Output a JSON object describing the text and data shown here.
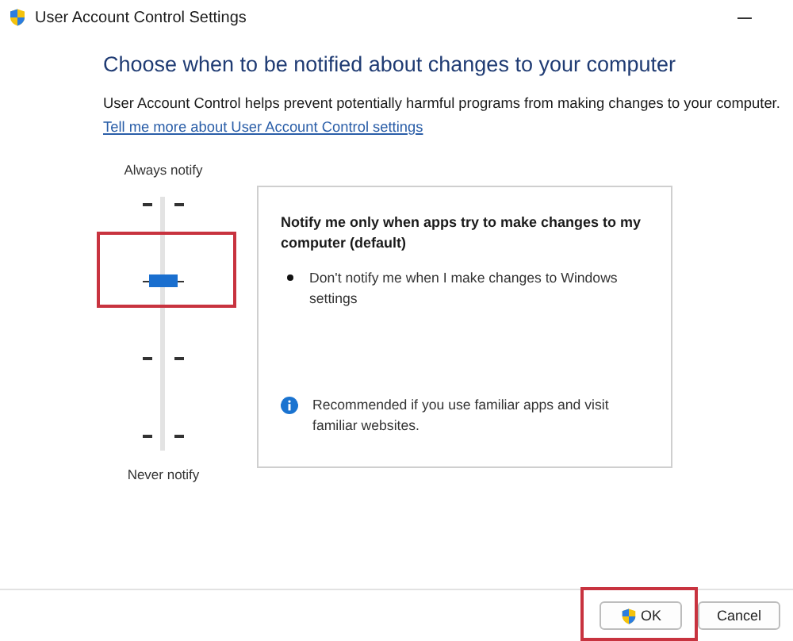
{
  "window": {
    "title": "User Account Control Settings"
  },
  "heading": "Choose when to be notified about changes to your computer",
  "description": "User Account Control helps prevent potentially harmful programs from making changes to your computer.",
  "link": "Tell me more about User Account Control settings",
  "slider": {
    "top_label": "Always notify",
    "bottom_label": "Never notify",
    "level": 0.667,
    "highlighted": true
  },
  "info_card": {
    "title": "Notify me only when apps try to make changes to my computer (default)",
    "bullets": [
      "Don't notify me when I make changes to Windows settings"
    ],
    "note": "Recommended if you use familiar apps and visit familiar websites."
  },
  "buttons": [
    {
      "label": "OK",
      "kind": "shield",
      "highlighted": true
    },
    {
      "label": "Cancel",
      "kind": "plain",
      "highlighted": false
    }
  ]
}
